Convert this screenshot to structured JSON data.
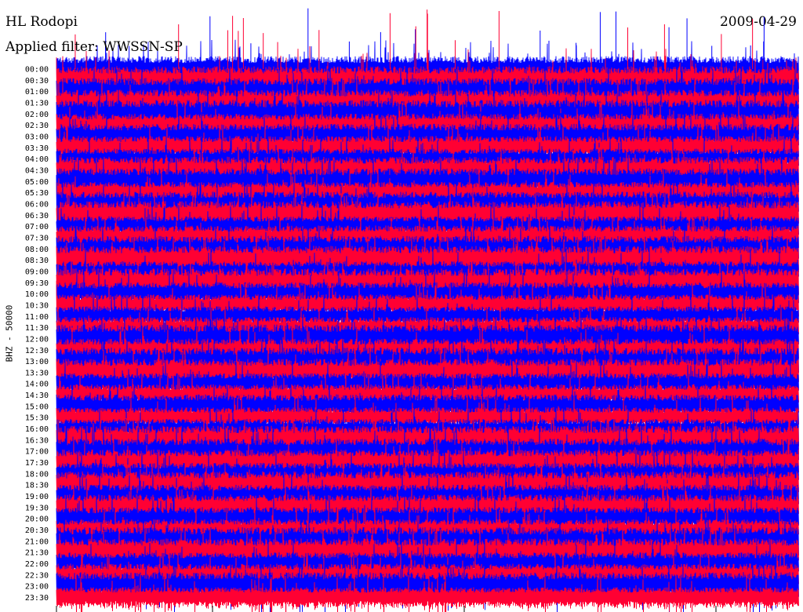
{
  "header": {
    "station": "HL Rodopi",
    "date": "2009-04-29",
    "filter": "Applied filter: WWSSN-SP"
  },
  "channel_label": "BHZ - 50000",
  "colors": {
    "trace_a": "#0000ff",
    "trace_b": "#ff0033",
    "background": "#ffffff"
  },
  "chart_data": {
    "type": "line",
    "title": "HL Rodopi",
    "subtitle": "Applied filter: WWSSN-SP",
    "ylabel": "BHZ - 50000",
    "row_labels": [
      "00:00",
      "00:30",
      "01:00",
      "01:30",
      "02:00",
      "02:30",
      "03:00",
      "03:30",
      "04:00",
      "04:30",
      "05:00",
      "05:30",
      "06:00",
      "06:30",
      "07:00",
      "07:30",
      "08:00",
      "08:30",
      "09:00",
      "09:30",
      "10:00",
      "10:30",
      "11:00",
      "11:30",
      "12:00",
      "12:30",
      "13:00",
      "13:30",
      "14:00",
      "14:30",
      "15:00",
      "15:30",
      "16:00",
      "16:30",
      "17:00",
      "17:30",
      "18:00",
      "18:30",
      "19:00",
      "19:30",
      "20:00",
      "20:30",
      "21:00",
      "21:30",
      "22:00",
      "22:30",
      "23:00",
      "23:30"
    ],
    "series_colors": [
      "#0000ff",
      "#ff0033"
    ],
    "grid": false
  }
}
